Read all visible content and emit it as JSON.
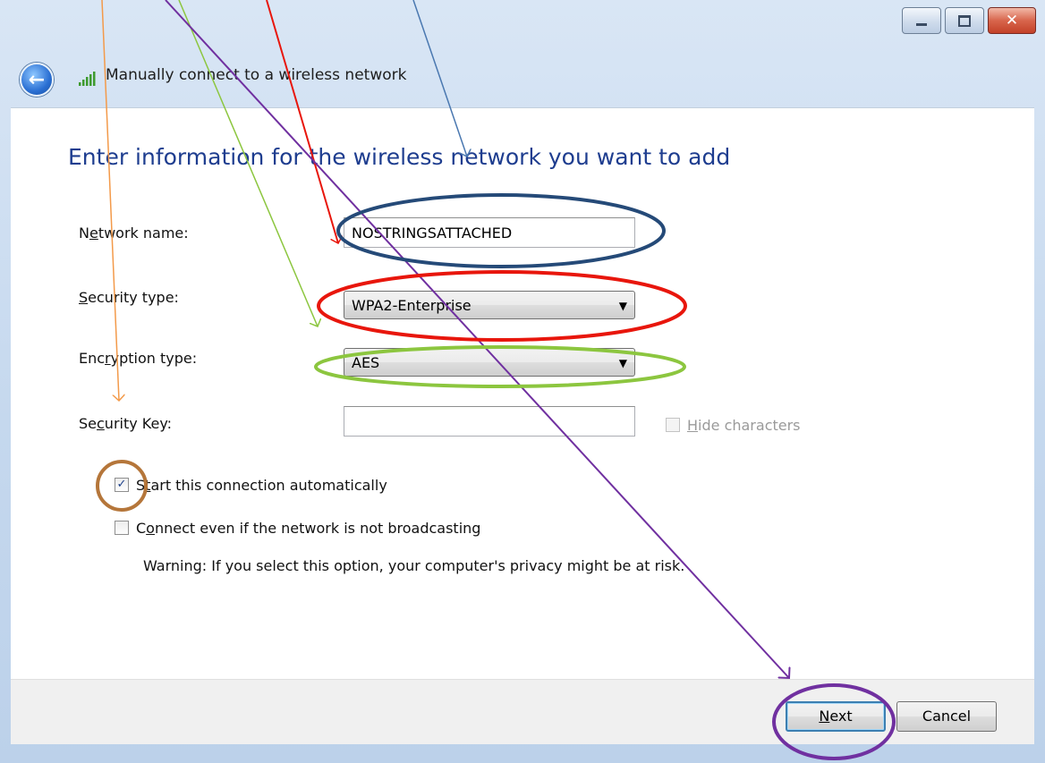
{
  "window": {
    "caption_buttons": {
      "minimize": "minimize-icon",
      "maximize": "maximize-icon",
      "close": "close-icon"
    }
  },
  "header": {
    "title": "Manually connect to a wireless network",
    "back_icon": "back-arrow-icon",
    "signal_icon": "wireless-signal-icon"
  },
  "form": {
    "heading": "Enter information for the wireless network you want to add",
    "network_name": {
      "label_pre": "N",
      "label_key": "e",
      "label_post": "twork name:",
      "value": "NOSTRINGSATTACHED"
    },
    "security_type": {
      "label_pre": "",
      "label_key": "S",
      "label_post": "ecurity type:",
      "value": "WPA2-Enterprise"
    },
    "encryption_type": {
      "label_pre": "Enc",
      "label_key": "r",
      "label_post": "yption type:",
      "value": "AES"
    },
    "security_key": {
      "label_pre": "Se",
      "label_key": "c",
      "label_post": "urity Key:",
      "value": ""
    },
    "hide_characters": {
      "label_key": "H",
      "label_post": "ide characters",
      "checked": false,
      "enabled": false
    },
    "start_auto": {
      "label_pre": "S",
      "label_key": "t",
      "label_post": "art this connection automatically",
      "checked": true
    },
    "connect_hidden": {
      "label_pre": "C",
      "label_key": "o",
      "label_post": "nnect even if the network is not broadcasting",
      "checked": false
    },
    "warning": "Warning: If you select this option, your computer's privacy might be at risk."
  },
  "buttons": {
    "next_key": "N",
    "next_rest": "ext",
    "cancel": "Cancel"
  },
  "colors": {
    "heading": "#1e3d8f",
    "annotation_orange": "#f39a4a",
    "annotation_green": "#8cc63f",
    "annotation_red": "#e8160c",
    "annotation_blue": "#4a78b0",
    "annotation_purple": "#7030a0",
    "annotation_brown": "#b5763a",
    "annotation_navy": "#254a78"
  }
}
